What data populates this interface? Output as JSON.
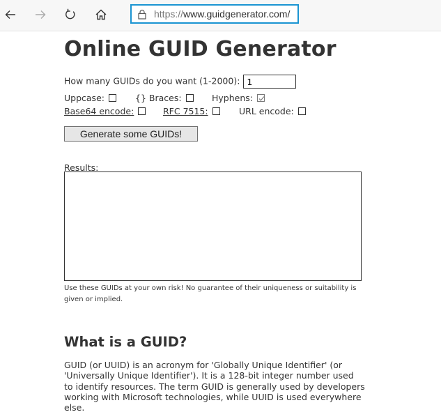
{
  "browser": {
    "url": "https://www.guidgenerator.com/",
    "url_scheme": "https://",
    "url_host": "www.guidgenerator.com/",
    "icons": [
      "back-icon",
      "forward-icon",
      "refresh-icon",
      "home-icon",
      "lock-icon"
    ]
  },
  "page": {
    "title": "Online GUID Generator",
    "how_many_label": "How many GUIDs do you want (1-2000):",
    "how_many_value": "1",
    "options": {
      "uppcase": {
        "label": "Uppcase:",
        "checked": false
      },
      "braces_glyph": "{}",
      "braces": {
        "label": "Braces:",
        "checked": false
      },
      "hyphens": {
        "label": "Hyphens:",
        "checked": true
      },
      "base64": {
        "label": "Base64 encode:",
        "checked": false
      },
      "rfc7515": {
        "label": "RFC 7515:",
        "checked": false
      },
      "urlencode": {
        "label": "URL encode:",
        "checked": false
      }
    },
    "generate_button": "Generate some GUIDs!",
    "results_label": "Results:",
    "results_value": "",
    "disclaimer": "Use these GUIDs at your own risk! No guarantee of their uniqueness or suitability is given or implied.",
    "what_heading": "What is a GUID?",
    "what_paragraph": "GUID (or UUID) is an acronym for 'Globally Unique Identifier' (or 'Universally Unique Identifier'). It is a 128-bit integer number used to identify resources. The term GUID is generally used by developers working with Microsoft technologies, while UUID is used everywhere else."
  },
  "colors": {
    "address_border": "#1a94d2",
    "text": "#333333"
  }
}
